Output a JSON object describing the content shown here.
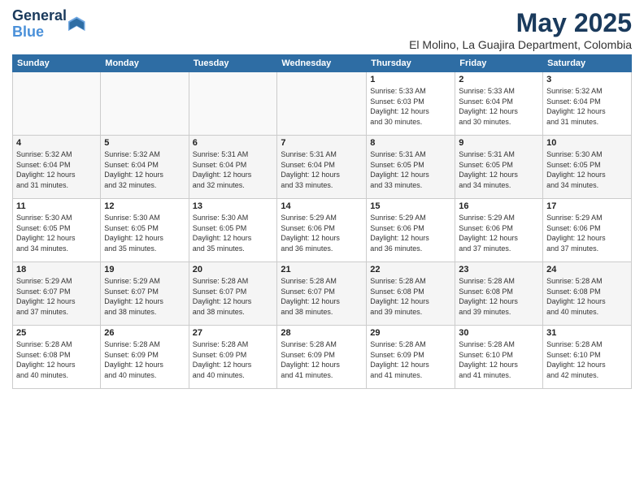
{
  "header": {
    "logo_line1": "General",
    "logo_line2": "Blue",
    "month": "May 2025",
    "location": "El Molino, La Guajira Department, Colombia"
  },
  "weekdays": [
    "Sunday",
    "Monday",
    "Tuesday",
    "Wednesday",
    "Thursday",
    "Friday",
    "Saturday"
  ],
  "weeks": [
    [
      {
        "day": "",
        "info": ""
      },
      {
        "day": "",
        "info": ""
      },
      {
        "day": "",
        "info": ""
      },
      {
        "day": "",
        "info": ""
      },
      {
        "day": "1",
        "info": "Sunrise: 5:33 AM\nSunset: 6:03 PM\nDaylight: 12 hours\nand 30 minutes."
      },
      {
        "day": "2",
        "info": "Sunrise: 5:33 AM\nSunset: 6:04 PM\nDaylight: 12 hours\nand 30 minutes."
      },
      {
        "day": "3",
        "info": "Sunrise: 5:32 AM\nSunset: 6:04 PM\nDaylight: 12 hours\nand 31 minutes."
      }
    ],
    [
      {
        "day": "4",
        "info": "Sunrise: 5:32 AM\nSunset: 6:04 PM\nDaylight: 12 hours\nand 31 minutes."
      },
      {
        "day": "5",
        "info": "Sunrise: 5:32 AM\nSunset: 6:04 PM\nDaylight: 12 hours\nand 32 minutes."
      },
      {
        "day": "6",
        "info": "Sunrise: 5:31 AM\nSunset: 6:04 PM\nDaylight: 12 hours\nand 32 minutes."
      },
      {
        "day": "7",
        "info": "Sunrise: 5:31 AM\nSunset: 6:04 PM\nDaylight: 12 hours\nand 33 minutes."
      },
      {
        "day": "8",
        "info": "Sunrise: 5:31 AM\nSunset: 6:05 PM\nDaylight: 12 hours\nand 33 minutes."
      },
      {
        "day": "9",
        "info": "Sunrise: 5:31 AM\nSunset: 6:05 PM\nDaylight: 12 hours\nand 34 minutes."
      },
      {
        "day": "10",
        "info": "Sunrise: 5:30 AM\nSunset: 6:05 PM\nDaylight: 12 hours\nand 34 minutes."
      }
    ],
    [
      {
        "day": "11",
        "info": "Sunrise: 5:30 AM\nSunset: 6:05 PM\nDaylight: 12 hours\nand 34 minutes."
      },
      {
        "day": "12",
        "info": "Sunrise: 5:30 AM\nSunset: 6:05 PM\nDaylight: 12 hours\nand 35 minutes."
      },
      {
        "day": "13",
        "info": "Sunrise: 5:30 AM\nSunset: 6:05 PM\nDaylight: 12 hours\nand 35 minutes."
      },
      {
        "day": "14",
        "info": "Sunrise: 5:29 AM\nSunset: 6:06 PM\nDaylight: 12 hours\nand 36 minutes."
      },
      {
        "day": "15",
        "info": "Sunrise: 5:29 AM\nSunset: 6:06 PM\nDaylight: 12 hours\nand 36 minutes."
      },
      {
        "day": "16",
        "info": "Sunrise: 5:29 AM\nSunset: 6:06 PM\nDaylight: 12 hours\nand 37 minutes."
      },
      {
        "day": "17",
        "info": "Sunrise: 5:29 AM\nSunset: 6:06 PM\nDaylight: 12 hours\nand 37 minutes."
      }
    ],
    [
      {
        "day": "18",
        "info": "Sunrise: 5:29 AM\nSunset: 6:07 PM\nDaylight: 12 hours\nand 37 minutes."
      },
      {
        "day": "19",
        "info": "Sunrise: 5:29 AM\nSunset: 6:07 PM\nDaylight: 12 hours\nand 38 minutes."
      },
      {
        "day": "20",
        "info": "Sunrise: 5:28 AM\nSunset: 6:07 PM\nDaylight: 12 hours\nand 38 minutes."
      },
      {
        "day": "21",
        "info": "Sunrise: 5:28 AM\nSunset: 6:07 PM\nDaylight: 12 hours\nand 38 minutes."
      },
      {
        "day": "22",
        "info": "Sunrise: 5:28 AM\nSunset: 6:08 PM\nDaylight: 12 hours\nand 39 minutes."
      },
      {
        "day": "23",
        "info": "Sunrise: 5:28 AM\nSunset: 6:08 PM\nDaylight: 12 hours\nand 39 minutes."
      },
      {
        "day": "24",
        "info": "Sunrise: 5:28 AM\nSunset: 6:08 PM\nDaylight: 12 hours\nand 40 minutes."
      }
    ],
    [
      {
        "day": "25",
        "info": "Sunrise: 5:28 AM\nSunset: 6:08 PM\nDaylight: 12 hours\nand 40 minutes."
      },
      {
        "day": "26",
        "info": "Sunrise: 5:28 AM\nSunset: 6:09 PM\nDaylight: 12 hours\nand 40 minutes."
      },
      {
        "day": "27",
        "info": "Sunrise: 5:28 AM\nSunset: 6:09 PM\nDaylight: 12 hours\nand 40 minutes."
      },
      {
        "day": "28",
        "info": "Sunrise: 5:28 AM\nSunset: 6:09 PM\nDaylight: 12 hours\nand 41 minutes."
      },
      {
        "day": "29",
        "info": "Sunrise: 5:28 AM\nSunset: 6:09 PM\nDaylight: 12 hours\nand 41 minutes."
      },
      {
        "day": "30",
        "info": "Sunrise: 5:28 AM\nSunset: 6:10 PM\nDaylight: 12 hours\nand 41 minutes."
      },
      {
        "day": "31",
        "info": "Sunrise: 5:28 AM\nSunset: 6:10 PM\nDaylight: 12 hours\nand 42 minutes."
      }
    ]
  ]
}
